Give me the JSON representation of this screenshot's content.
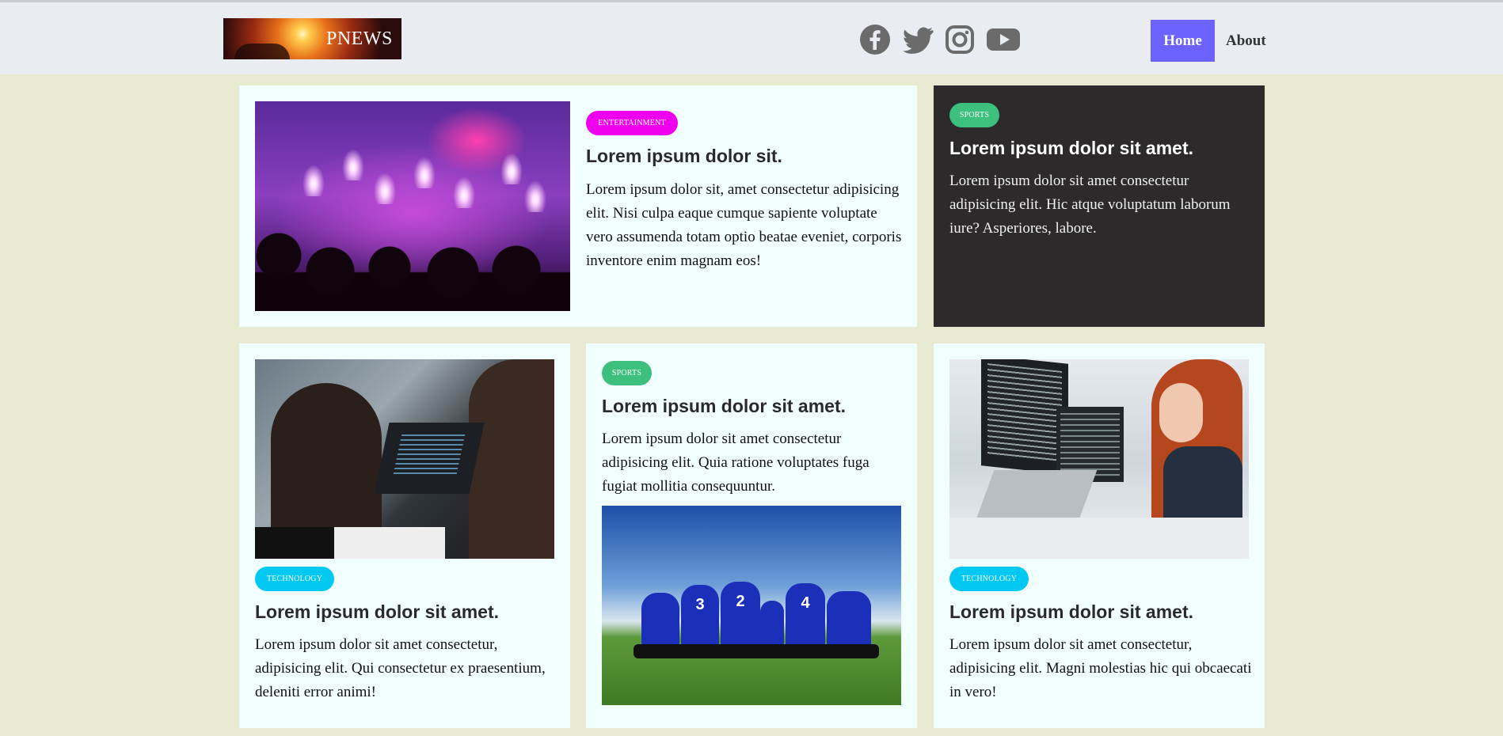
{
  "header": {
    "logo_text": "PNEWS",
    "social_icons": [
      "facebook-icon",
      "twitter-icon",
      "instagram-icon",
      "youtube-icon"
    ],
    "nav": {
      "home": "Home",
      "about": "About"
    },
    "colors": {
      "header_bg": "#e9edf1",
      "nav_active": "#6c63ff"
    }
  },
  "colors": {
    "page_bg": "#e8e9d1",
    "card_bg": "#f0fffe",
    "dark_card_bg": "#2c2a2a",
    "badge_entertainment": "#ee00ee",
    "badge_sports": "#3dbf7e",
    "badge_technology": "#00c8f0"
  },
  "cards": [
    {
      "category": "ENTERTAINMENT",
      "title": "Lorem ipsum dolor sit.",
      "body": "Lorem ipsum dolor sit, amet consectetur adipisicing elit. Nisi culpa eaque cumque sapiente voluptate vero assumenda totam optio beatae eveniet, corporis inventore enim magnam eos!"
    },
    {
      "category": "SPORTS",
      "title": "Lorem ipsum dolor sit amet.",
      "body": "Lorem ipsum dolor sit amet consectetur adipisicing elit. Hic atque voluptatum laborum iure? Asperiores, labore."
    },
    {
      "category": "TECHNOLOGY",
      "title": "Lorem ipsum dolor sit amet.",
      "body": "Lorem ipsum dolor sit amet consectetur, adipisicing elit. Qui consectetur ex praesentium, deleniti error animi!"
    },
    {
      "category": "SPORTS",
      "title": "Lorem ipsum dolor sit amet.",
      "body": "Lorem ipsum dolor sit amet consectetur adipisicing elit. Quia ratione voluptates fuga fugiat mollitia consequuntur."
    },
    {
      "category": "TECHNOLOGY",
      "title": "Lorem ipsum dolor sit amet.",
      "body": "Lorem ipsum dolor sit amet consectetur, adipisicing elit. Magni molestias hic qui obcaecati in vero!"
    }
  ],
  "jerseys": [
    "3",
    "2",
    "4"
  ]
}
